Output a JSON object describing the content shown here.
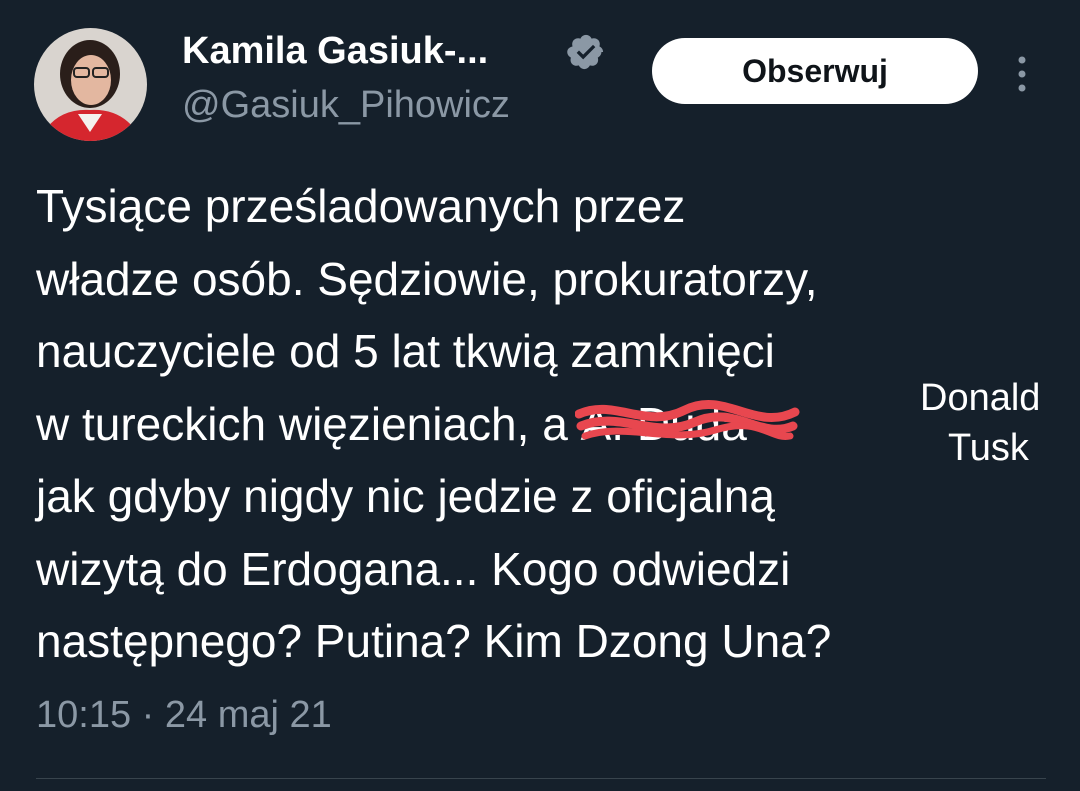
{
  "author": {
    "name": "Kamila Gasiuk-...",
    "handle": "@Gasiuk_Pihowicz",
    "verified_icon": "verified-badge-icon",
    "badge_color": "#8b98a5"
  },
  "actions": {
    "follow_label": "Obserwuj",
    "more_icon": "more-vertical-icon"
  },
  "tweet": {
    "lines": [
      "Tysiące prześladowanych przez",
      "władze osób. Sędziowie, prokuratorzy,",
      "nauczyciele od 5 lat tkwią zamknięci",
      "w tureckich więzieniach, a ",
      "jak gdyby nigdy nic jedzie z oficjalną",
      "wizytą do Erdogana... Kogo odwiedzi",
      "następnego? Putina? Kim Dzong Una?"
    ],
    "struck_text": "A. Duda",
    "correction": [
      "Donald",
      "Tusk"
    ],
    "scribble_color": "#e8474f"
  },
  "timestamp": "10:15 · 24 maj 21",
  "colors": {
    "background": "#15202b",
    "text": "#ffffff",
    "secondary": "#8b98a5"
  }
}
